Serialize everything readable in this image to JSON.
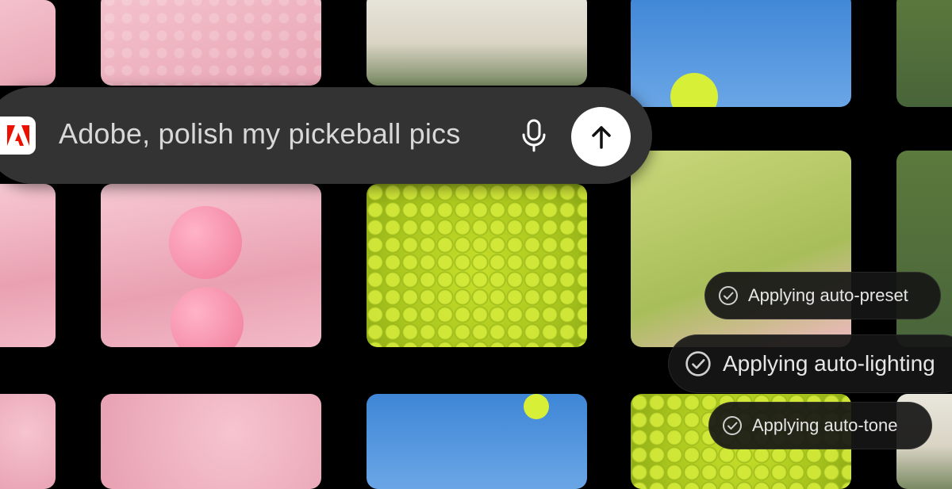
{
  "search": {
    "brand_icon": "adobe-logo-icon",
    "prompt_text": "Adobe, polish my pickeball pics",
    "mic_icon": "microphone-icon",
    "send_icon": "arrow-up-icon"
  },
  "status_pills": [
    {
      "label": "Applying auto-preset",
      "icon": "check-circle-icon"
    },
    {
      "label": "Applying auto-lighting",
      "icon": "check-circle-icon"
    },
    {
      "label": "Applying auto-tone",
      "icon": "check-circle-icon"
    }
  ],
  "colors": {
    "background": "#000000",
    "bar": "#333334",
    "adobe_red": "#eb1000",
    "pill_bg": "#161616"
  }
}
